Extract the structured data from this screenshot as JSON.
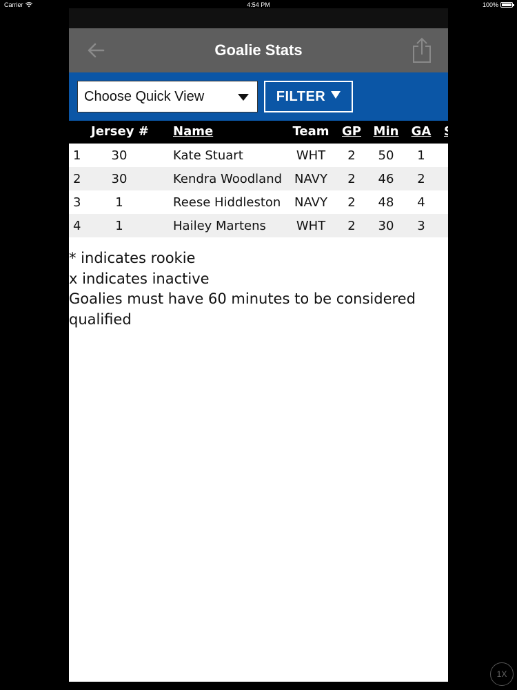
{
  "status_bar": {
    "carrier": "Carrier",
    "time": "4:54 PM",
    "battery": "100%"
  },
  "navbar": {
    "title": "Goalie Stats",
    "back_icon": "arrow-left-icon",
    "share_icon": "share-icon",
    "color": "#5e5e5e"
  },
  "filters": {
    "quick_view_label": "Choose Quick View",
    "filter_label": "FILTER",
    "bar_color": "#0b56a6"
  },
  "table": {
    "headers": {
      "jersey": "Jersey #",
      "name": "Name",
      "team": "Team",
      "gp": "GP",
      "min": "Min",
      "ga": "GA",
      "next": "S"
    },
    "rows": [
      {
        "rank": "1",
        "jersey": "30",
        "name": "Kate Stuart",
        "team": "WHT",
        "gp": "2",
        "min": "50",
        "ga": "1"
      },
      {
        "rank": "2",
        "jersey": "30",
        "name": "Kendra Woodland",
        "team": "NAVY",
        "gp": "2",
        "min": "46",
        "ga": "2"
      },
      {
        "rank": "3",
        "jersey": "1",
        "name": "Reese Hiddleston",
        "team": "NAVY",
        "gp": "2",
        "min": "48",
        "ga": "4"
      },
      {
        "rank": "4",
        "jersey": "1",
        "name": "Hailey Martens",
        "team": "WHT",
        "gp": "2",
        "min": "30",
        "ga": "3"
      }
    ]
  },
  "notes": {
    "rookie": "* indicates rookie",
    "inactive": "x indicates inactive",
    "qualified": "Goalies must have 60 minutes to be considered qualified"
  },
  "speed_badge": "1X"
}
